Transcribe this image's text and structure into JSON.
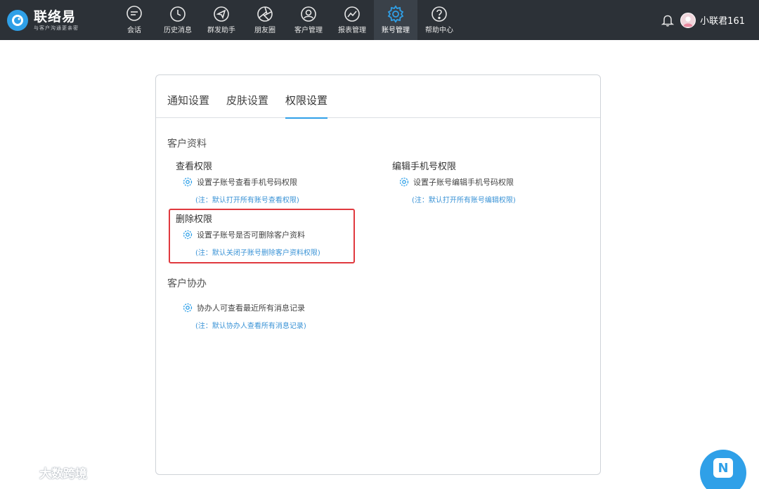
{
  "brand": {
    "name": "联络易",
    "slogan": "与客户沟通更亲密"
  },
  "nav": [
    {
      "label": "会话",
      "icon": "chat-bubble-icon",
      "active": false
    },
    {
      "label": "历史消息",
      "icon": "clock-icon",
      "active": false
    },
    {
      "label": "群发助手",
      "icon": "paper-plane-icon",
      "active": false
    },
    {
      "label": "朋友圈",
      "icon": "aperture-icon",
      "active": false
    },
    {
      "label": "客户管理",
      "icon": "user-circle-icon",
      "active": false
    },
    {
      "label": "报表管理",
      "icon": "chart-icon",
      "active": false
    },
    {
      "label": "账号管理",
      "icon": "gear-icon",
      "active": true
    },
    {
      "label": "帮助中心",
      "icon": "question-icon",
      "active": false
    }
  ],
  "user": {
    "name": "小联君161"
  },
  "tabs": [
    {
      "label": "通知设置",
      "active": false
    },
    {
      "label": "皮肤设置",
      "active": false
    },
    {
      "label": "权限设置",
      "active": true
    }
  ],
  "sections": {
    "customer_info": {
      "title": "客户资料",
      "view": {
        "title": "查看权限",
        "setting": "设置子账号查看手机号码权限",
        "note": "(注：默认打开所有账号查看权限)"
      },
      "edit": {
        "title": "编辑手机号权限",
        "setting": "设置子账号编辑手机号码权限",
        "note": "(注：默认打开所有账号编辑权限)"
      },
      "delete": {
        "title": "删除权限",
        "setting": "设置子账号是否可删除客户资料",
        "note": "(注：默认关闭子账号删除客户资料权限)"
      }
    },
    "collab": {
      "title": "客户协办",
      "setting": "协办人可查看最近所有消息记录",
      "note": "(注：默认协办人查看所有消息记录)"
    }
  },
  "watermark": {
    "text": "大数跨境"
  },
  "colors": {
    "topbar": "#2c3137",
    "accent": "#2fa0e8",
    "note": "#3a93d6",
    "highlight": "#e0393e"
  }
}
